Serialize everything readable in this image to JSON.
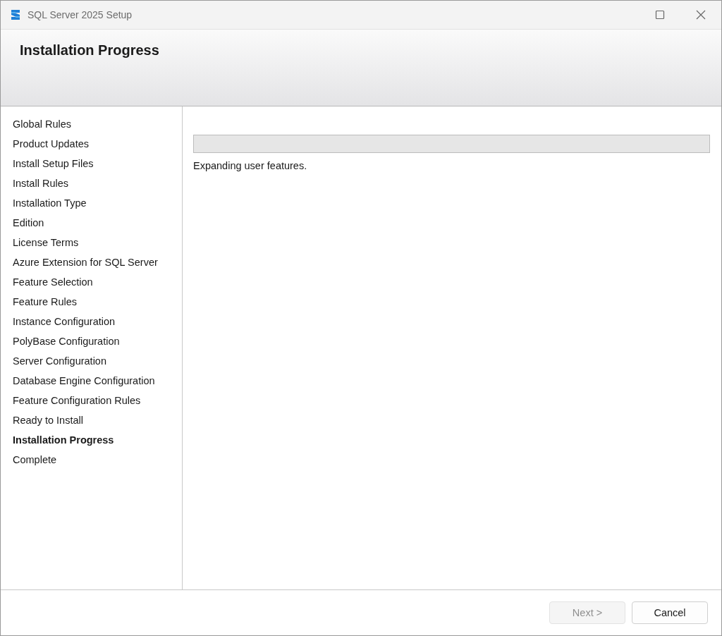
{
  "window": {
    "title": "SQL Server 2025 Setup"
  },
  "header": {
    "title": "Installation Progress"
  },
  "sidebar": {
    "items": [
      {
        "label": "Global Rules",
        "selected": false
      },
      {
        "label": "Product Updates",
        "selected": false
      },
      {
        "label": "Install Setup Files",
        "selected": false
      },
      {
        "label": "Install Rules",
        "selected": false
      },
      {
        "label": "Installation Type",
        "selected": false
      },
      {
        "label": "Edition",
        "selected": false
      },
      {
        "label": "License Terms",
        "selected": false
      },
      {
        "label": "Azure Extension for SQL Server",
        "selected": false
      },
      {
        "label": "Feature Selection",
        "selected": false
      },
      {
        "label": "Feature Rules",
        "selected": false
      },
      {
        "label": "Instance Configuration",
        "selected": false
      },
      {
        "label": "PolyBase Configuration",
        "selected": false
      },
      {
        "label": "Server Configuration",
        "selected": false
      },
      {
        "label": "Database Engine Configuration",
        "selected": false
      },
      {
        "label": "Feature Configuration Rules",
        "selected": false
      },
      {
        "label": "Ready to Install",
        "selected": false
      },
      {
        "label": "Installation Progress",
        "selected": true
      },
      {
        "label": "Complete",
        "selected": false
      }
    ]
  },
  "progress": {
    "level": 0,
    "status": "Expanding user features."
  },
  "buttons": [
    {
      "label": "Next >",
      "disabled": true
    },
    {
      "label": "Cancel",
      "disabled": false
    }
  ]
}
